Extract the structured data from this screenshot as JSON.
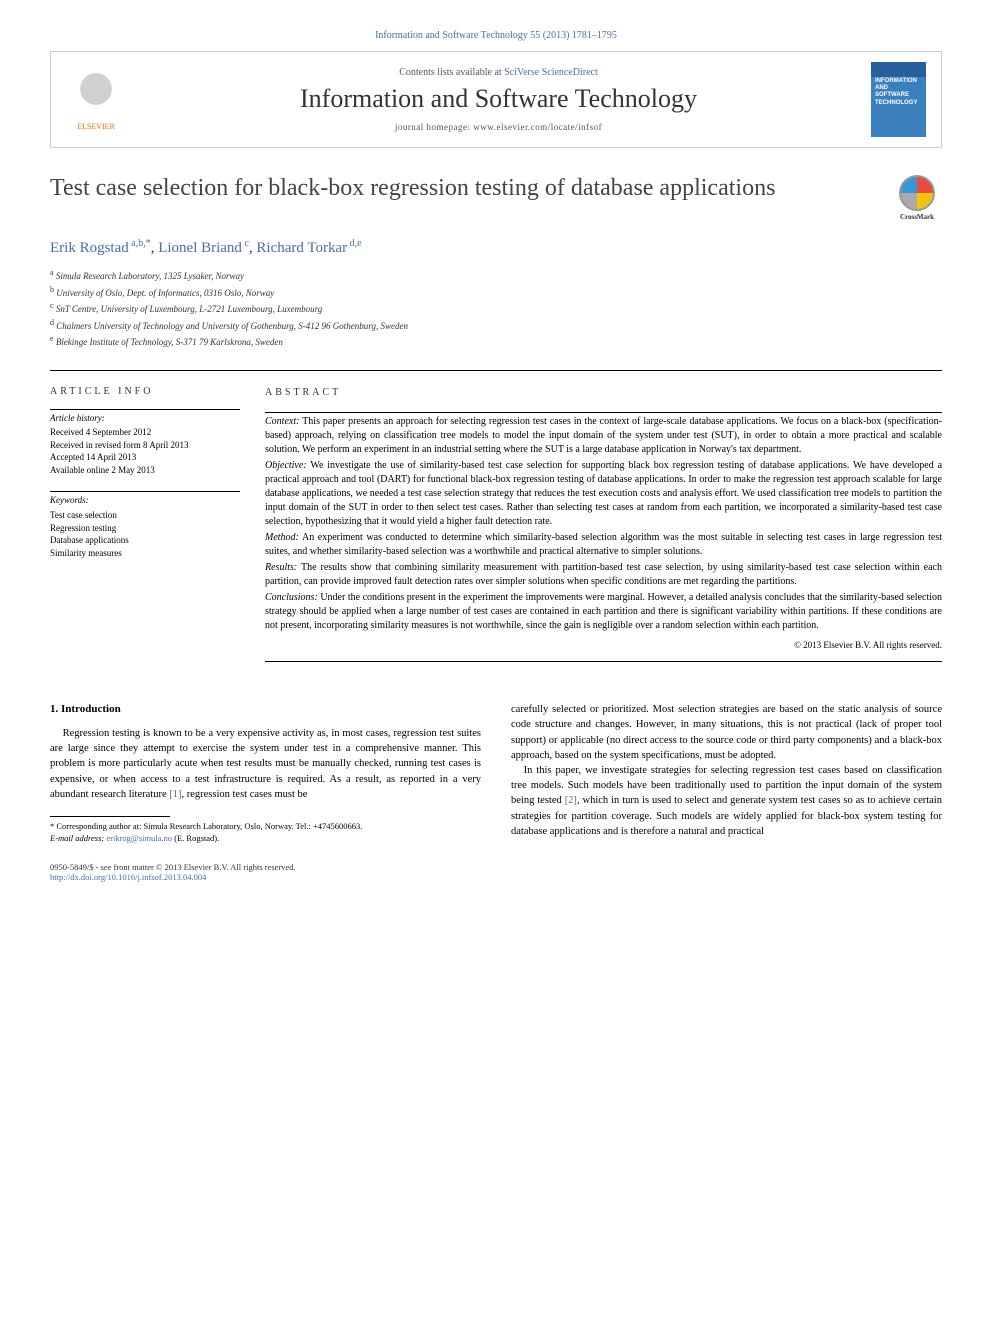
{
  "top_citation": "Information and Software Technology 55 (2013) 1781–1795",
  "header": {
    "publisher": "ELSEVIER",
    "contents_prefix": "Contents lists available at ",
    "contents_link": "SciVerse ScienceDirect",
    "journal": "Information and Software Technology",
    "homepage_prefix": "journal homepage: ",
    "homepage_url": "www.elsevier.com/locate/infsof",
    "cover_text": "INFORMATION AND SOFTWARE TECHNOLOGY"
  },
  "crossmark_label": "CrossMark",
  "title": "Test case selection for black-box regression testing of database applications",
  "authors_html": "Erik Rogstad<sup> a,b,*</sup>, Lionel Briand<sup> c</sup>, Richard Torkar<sup> d,e</sup>",
  "affiliations": {
    "a": "Simula Research Laboratory, 1325 Lysaker, Norway",
    "b": "University of Oslo, Dept. of Informatics, 0316 Oslo, Norway",
    "c": "SnT Centre, University of Luxembourg, L-2721 Luxembourg, Luxembourg",
    "d": "Chalmers University of Technology and University of Gothenburg, S-412 96 Gothenburg, Sweden",
    "e": "Blekinge Institute of Technology, S-371 79 Karlskrona, Sweden"
  },
  "article_info": {
    "heading": "ARTICLE INFO",
    "history_label": "Article history:",
    "received": "Received 4 September 2012",
    "revised": "Received in revised form 8 April 2013",
    "accepted": "Accepted 14 April 2013",
    "online": "Available online 2 May 2013",
    "keywords_label": "Keywords:",
    "keywords": [
      "Test case selection",
      "Regression testing",
      "Database applications",
      "Similarity measures"
    ]
  },
  "abstract": {
    "heading": "ABSTRACT",
    "context_label": "Context:",
    "context": "This paper presents an approach for selecting regression test cases in the context of large-scale database applications. We focus on a black-box (specification-based) approach, relying on classification tree models to model the input domain of the system under test (SUT), in order to obtain a more practical and scalable solution. We perform an experiment in an industrial setting where the SUT is a large database application in Norway's tax department.",
    "objective_label": "Objective:",
    "objective": "We investigate the use of similarity-based test case selection for supporting black box regression testing of database applications. We have developed a practical approach and tool (DART) for functional black-box regression testing of database applications. In order to make the regression test approach scalable for large database applications, we needed a test case selection strategy that reduces the test execution costs and analysis effort. We used classification tree models to partition the input domain of the SUT in order to then select test cases. Rather than selecting test cases at random from each partition, we incorporated a similarity-based test case selection, hypothesizing that it would yield a higher fault detection rate.",
    "method_label": "Method:",
    "method": "An experiment was conducted to determine which similarity-based selection algorithm was the most suitable in selecting test cases in large regression test suites, and whether similarity-based selection was a worthwhile and practical alternative to simpler solutions.",
    "results_label": "Results:",
    "results": "The results show that combining similarity measurement with partition-based test case selection, by using similarity-based test case selection within each partition, can provide improved fault detection rates over simpler solutions when specific conditions are met regarding the partitions.",
    "conclusions_label": "Conclusions:",
    "conclusions": "Under the conditions present in the experiment the improvements were marginal. However, a detailed analysis concludes that the similarity-based selection strategy should be applied when a large number of test cases are contained in each partition and there is significant variability within partitions. If these conditions are not present, incorporating similarity measures is not worthwhile, since the gain is negligible over a random selection within each partition.",
    "copyright": "© 2013 Elsevier B.V. All rights reserved."
  },
  "section1": {
    "heading": "1. Introduction",
    "p1a": "Regression testing is known to be a very expensive activity as, in most cases, regression test suites are large since they attempt to exercise the system under test in a comprehensive manner. This problem is more particularly acute when test results must be manually checked, running test cases is expensive, or when access to a test infrastructure is required. As a result, as reported in a very abundant research literature ",
    "p1_ref": "[1]",
    "p1b": ", regression test cases must be",
    "p2a": "carefully selected or prioritized. Most selection strategies are based on the static analysis of source code structure and changes. However, in many situations, this is not practical (lack of proper tool support) or applicable (no direct access to the source code or third party components) and a black-box approach, based on the system specifications, must be adopted.",
    "p3a": "In this paper, we investigate strategies for selecting regression test cases based on classification tree models. Such models have been traditionally used to partition the input domain of the system being tested ",
    "p3_ref": "[2]",
    "p3b": ", which in turn is used to select and generate system test cases so as to achieve certain strategies for partition coverage. Such models are widely applied for black-box system testing for database applications and is therefore a natural and practical"
  },
  "footnote": {
    "corr": "* Corresponding author at: Simula Research Laboratory, Oslo, Norway. Tel.: +4745600663.",
    "email_label": "E-mail address:",
    "email": "erikrog@simula.no",
    "email_suffix": " (E. Rogstad)."
  },
  "bottom": {
    "issn_line": "0950-5849/$ - see front matter © 2013 Elsevier B.V. All rights reserved.",
    "doi": "http://dx.doi.org/10.1016/j.infsof.2013.04.004"
  }
}
